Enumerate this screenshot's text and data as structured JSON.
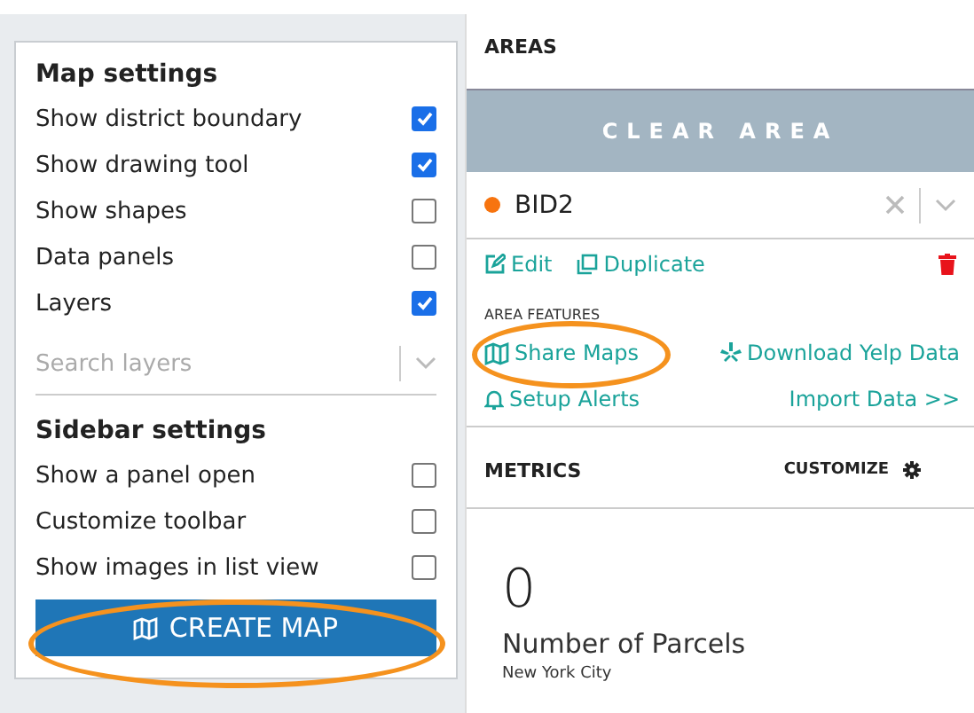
{
  "map_settings": {
    "title": "Map settings",
    "options": [
      {
        "label": "Show district boundary",
        "checked": true
      },
      {
        "label": "Show drawing tool",
        "checked": true
      },
      {
        "label": "Show shapes",
        "checked": false
      },
      {
        "label": "Data panels",
        "checked": false
      },
      {
        "label": "Layers",
        "checked": true
      }
    ],
    "search": {
      "placeholder": "Search layers"
    }
  },
  "sidebar_settings": {
    "title": "Sidebar settings",
    "options": [
      {
        "label": "Show a panel open",
        "checked": false
      },
      {
        "label": "Customize toolbar",
        "checked": false
      },
      {
        "label": "Show images in list view",
        "checked": false
      }
    ]
  },
  "create_button": "CREATE MAP",
  "areas": {
    "title": "AREAS",
    "clear_button": "CLEAR AREA",
    "area": {
      "name": "BID2",
      "color": "#f7740f"
    },
    "actions": [
      "Edit",
      "Duplicate"
    ],
    "features_label": "AREA FEATURES",
    "features": [
      {
        "label": "Share Maps"
      },
      {
        "label": "Download Yelp Data"
      },
      {
        "label": "Setup Alerts"
      },
      {
        "label": "Import Data >>"
      }
    ]
  },
  "metrics": {
    "title": "METRICS",
    "customize": "CUSTOMIZE",
    "value": "0",
    "label": "Number of Parcels",
    "sublabel": "New York City"
  }
}
